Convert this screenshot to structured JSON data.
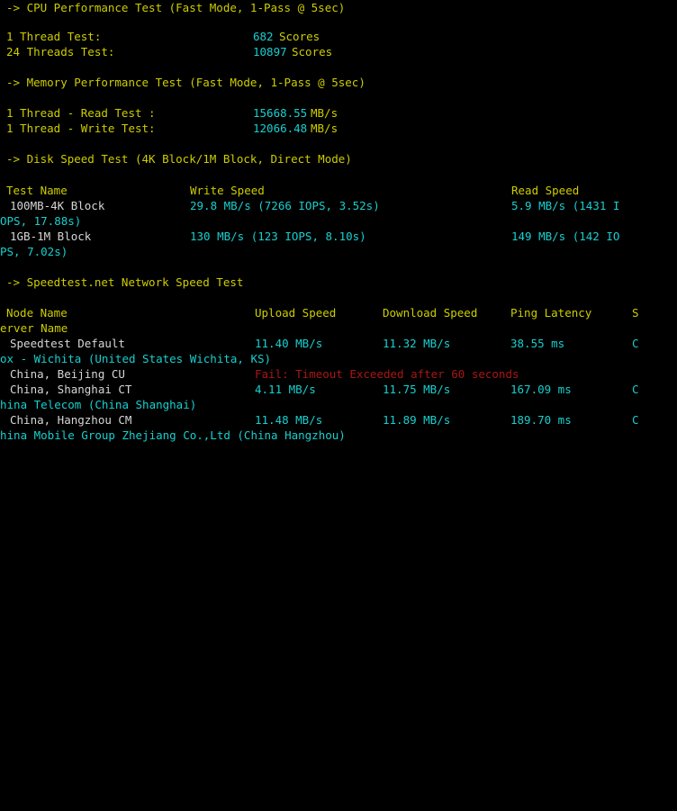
{
  "terminal": {
    "background": "#000000",
    "colors": {
      "header_yellow": "#cdcd00",
      "value_cyan": "#18cfcf",
      "label_white": "#d6d6d6",
      "error_red": "#a81616"
    },
    "char_width": 7.13,
    "line_height": 17,
    "wrap_columns": 105
  },
  "sections": {
    "cpu": {
      "heading": "-> CPU Performance Test (Fast Mode, 1-Pass @ 5sec)",
      "rows": [
        {
          "label": "1 Thread Test:",
          "value": "682",
          "unit": "Scores"
        },
        {
          "label": "24 Threads Test:",
          "value": "10897",
          "unit": "Scores"
        }
      ]
    },
    "memory": {
      "heading": "-> Memory Performance Test (Fast Mode, 1-Pass @ 5sec)",
      "rows": [
        {
          "label": "1 Thread - Read Test :",
          "value": "15668.55",
          "unit": "MB/s"
        },
        {
          "label": "1 Thread - Write Test:",
          "value": "12066.48",
          "unit": "MB/s"
        }
      ]
    },
    "disk": {
      "heading": "-> Disk Speed Test (4K Block/1M Block, Direct Mode)",
      "columns": {
        "test_name": "Test Name",
        "write_speed": "Write Speed",
        "read_speed": "Read Speed"
      },
      "rows": [
        {
          "name": "100MB-4K Block",
          "write": "29.8 MB/s (7266 IOPS, 3.52s)",
          "read_part1": "5.9 MB/s (1431 I",
          "read_part2": "OPS, 17.88s)"
        },
        {
          "name": "1GB-1M Block",
          "write": "130 MB/s (123 IOPS, 8.10s)",
          "read_part1": "149 MB/s (142 IO",
          "read_part2": "PS, 7.02s)"
        }
      ]
    },
    "speedtest": {
      "heading": "-> Speedtest.net Network Speed Test",
      "columns": {
        "node_name": "Node Name",
        "upload_speed": "Upload Speed",
        "download_speed": "Download Speed",
        "ping_latency": "Ping Latency",
        "server_name_part1": "S",
        "server_name_part2": "erver Name"
      },
      "rows": [
        {
          "node": "Speedtest Default",
          "upload": "11.40 MB/s",
          "download": "11.32 MB/s",
          "ping": "38.55 ms",
          "failed": false,
          "server_part1": "C",
          "server_part2": "ox - Wichita (United States Wichita, KS)"
        },
        {
          "node": "China, Beijing CU",
          "error": "Fail: Timeout Exceeded after 60 seconds",
          "failed": true,
          "server_part1": "",
          "server_part2": ""
        },
        {
          "node": "China, Shanghai CT",
          "upload": "4.11 MB/s",
          "download": "11.75 MB/s",
          "ping": "167.09 ms",
          "failed": false,
          "server_part1": "C",
          "server_part2": "hina Telecom (China Shanghai)"
        },
        {
          "node": "China, Hangzhou CM",
          "upload": "11.48 MB/s",
          "download": "11.89 MB/s",
          "ping": "189.70 ms",
          "failed": false,
          "server_part1": "C",
          "server_part2": "hina Mobile Group Zhejiang Co.,Ltd (China Hangzhou)"
        }
      ]
    }
  }
}
